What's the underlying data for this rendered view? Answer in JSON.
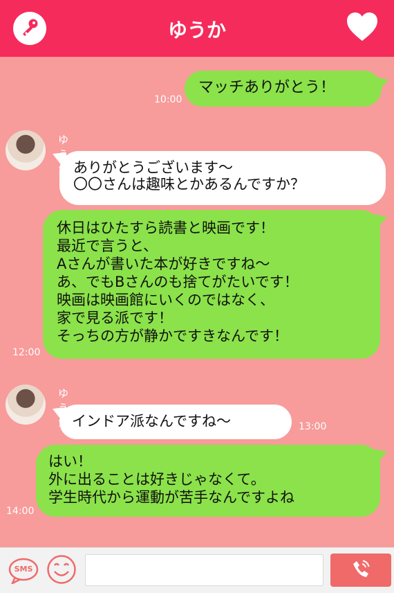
{
  "header": {
    "title": "ゆうか",
    "left_icon": "key-icon",
    "right_icon": "heart-icon"
  },
  "messages": [
    {
      "side": "right",
      "text": "マッチありがとう！",
      "time": "10:00"
    },
    {
      "side": "left",
      "sender": "ゆうか",
      "text": "ありがとうございます〜\n〇〇さんは趣味とかあるんですか？"
    },
    {
      "side": "right",
      "text": "休日はひたすら読書と映画です！\n最近で言うと、\nAさんが書いた本が好きですね〜\nあ、でもBさんのも捨てがたいです！\n映画は映画館にいくのではなく、\n家で見る派です！\nそっちの方が静かですきなんです！",
      "time": "12:00"
    },
    {
      "side": "left",
      "sender": "ゆうか",
      "text": "インドア派なんですね〜",
      "time": "13:00"
    },
    {
      "side": "right",
      "text": "はい！\n外に出ることは好きじゃなくて。\n学生時代から運動が苦手なんですよね",
      "time": "14:00"
    }
  ],
  "footer": {
    "sms_label": "SMS",
    "sms_icon": "sms-icon",
    "emoji_icon": "smiley-icon",
    "input_value": "",
    "call_icon": "phone-icon"
  },
  "colors": {
    "header": "#f52b5b",
    "background": "#f89b9b",
    "sent_bubble": "#8be24a",
    "received_bubble": "#ffffff",
    "call_button": "#f06a6a"
  }
}
